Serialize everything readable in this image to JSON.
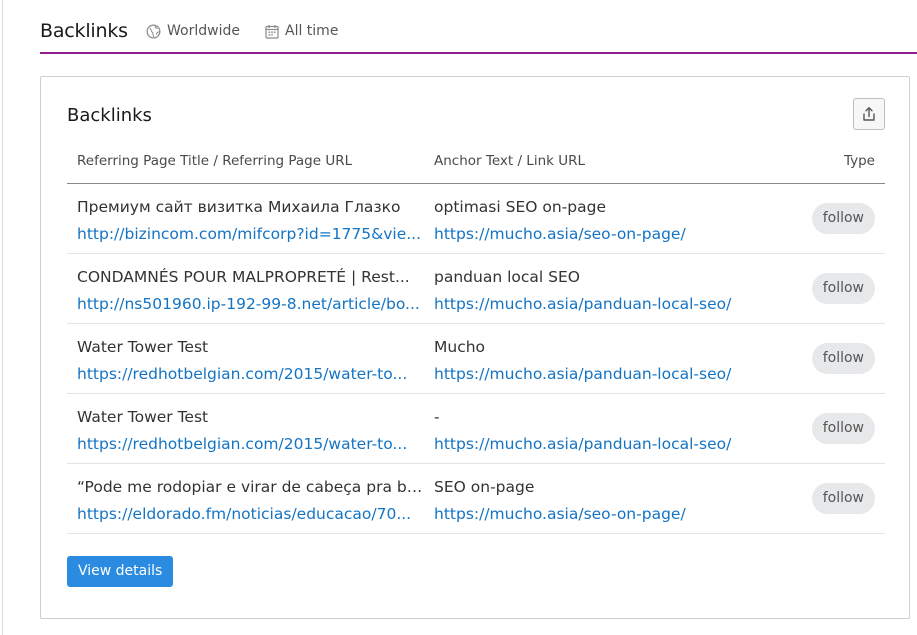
{
  "header": {
    "title": "Backlinks",
    "region_label": "Worldwide",
    "period_label": "All time",
    "accent_color": "#8f1c8c"
  },
  "card": {
    "title": "Backlinks",
    "export_icon": "export-icon",
    "columns": {
      "referring": "Referring Page Title / Referring Page URL",
      "anchor": "Anchor Text / Link URL",
      "type": "Type"
    },
    "rows": [
      {
        "title": "Премиум сайт визитка Михаила Глазко",
        "url": "http://bizincom.com/mifcorp?id=1775&vie...",
        "anchor": "optimasi SEO on-page",
        "link": "https://mucho.asia/seo-on-page/",
        "type": "follow"
      },
      {
        "title": "CONDAMNÉS POUR MALPROPRETÉ | Rest...",
        "url": "http://ns501960.ip-192-99-8.net/article/bo...",
        "anchor": "panduan local SEO",
        "link": "https://mucho.asia/panduan-local-seo/",
        "type": "follow"
      },
      {
        "title": "Water Tower Test",
        "url": "https://redhotbelgian.com/2015/water-to...",
        "anchor": "Mucho",
        "link": "https://mucho.asia/panduan-local-seo/",
        "type": "follow"
      },
      {
        "title": "Water Tower Test",
        "url": "https://redhotbelgian.com/2015/water-to...",
        "anchor": "-",
        "link": "https://mucho.asia/panduan-local-seo/",
        "type": "follow"
      },
      {
        "title": "“Pode me rodopiar e virar de cabeça pra ba...",
        "url": "https://eldorado.fm/noticias/educacao/70...",
        "anchor": "SEO on-page",
        "link": "https://mucho.asia/seo-on-page/",
        "type": "follow"
      }
    ],
    "view_details_label": "View details",
    "link_color": "#1474c4",
    "button_color": "#2a8be0"
  }
}
